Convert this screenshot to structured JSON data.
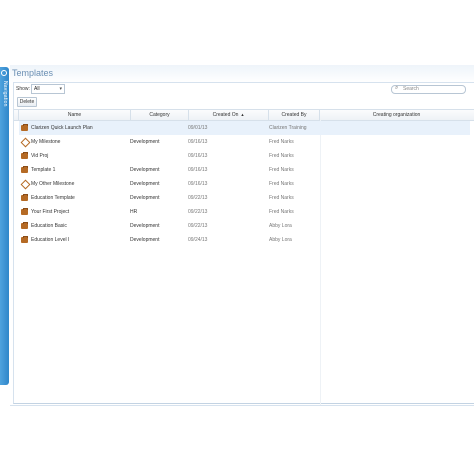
{
  "navigation": {
    "label": "Navigation"
  },
  "window": {
    "title": "Templates"
  },
  "toolbar": {
    "show_label": "Show:",
    "show_value": "All",
    "search_placeholder": "Search",
    "delete_label": "Delete"
  },
  "grid": {
    "columns": [
      "Name",
      "Category",
      "Created On",
      "Created By",
      "Creating organization"
    ],
    "sort_column": "Created On",
    "sort_indicator": "▲",
    "rows": [
      {
        "name": "Clarizen Quick Launch Plan",
        "category": "",
        "created_on": "09/01/13",
        "created_by": "Clarizen Training",
        "icon": "briefcase-icon",
        "selected": true
      },
      {
        "name": "My Milestone",
        "category": "Development",
        "created_on": "09/16/13",
        "created_by": "Fred Narks",
        "icon": "milestone-icon",
        "selected": false
      },
      {
        "name": "Vid Proj",
        "category": "",
        "created_on": "09/16/13",
        "created_by": "Fred Narks",
        "icon": "briefcase-icon",
        "selected": false
      },
      {
        "name": "Template 1",
        "category": "Development",
        "created_on": "09/16/13",
        "created_by": "Fred Narks",
        "icon": "briefcase-icon",
        "selected": false
      },
      {
        "name": "My Other Milestone",
        "category": "Development",
        "created_on": "09/16/13",
        "created_by": "Fred Narks",
        "icon": "milestone-icon",
        "selected": false
      },
      {
        "name": "Education Template",
        "category": "Development",
        "created_on": "09/22/13",
        "created_by": "Fred Narks",
        "icon": "briefcase-icon",
        "selected": false
      },
      {
        "name": "Your First Project",
        "category": "HR",
        "created_on": "09/22/13",
        "created_by": "Fred Narks",
        "icon": "briefcase-icon",
        "selected": false
      },
      {
        "name": "Education Basic",
        "category": "Development",
        "created_on": "09/22/13",
        "created_by": "Abby Lora",
        "icon": "briefcase-icon",
        "selected": false
      },
      {
        "name": "Education Level I",
        "category": "Development",
        "created_on": "09/24/13",
        "created_by": "Abby Lora",
        "icon": "briefcase-icon",
        "selected": false
      }
    ]
  }
}
